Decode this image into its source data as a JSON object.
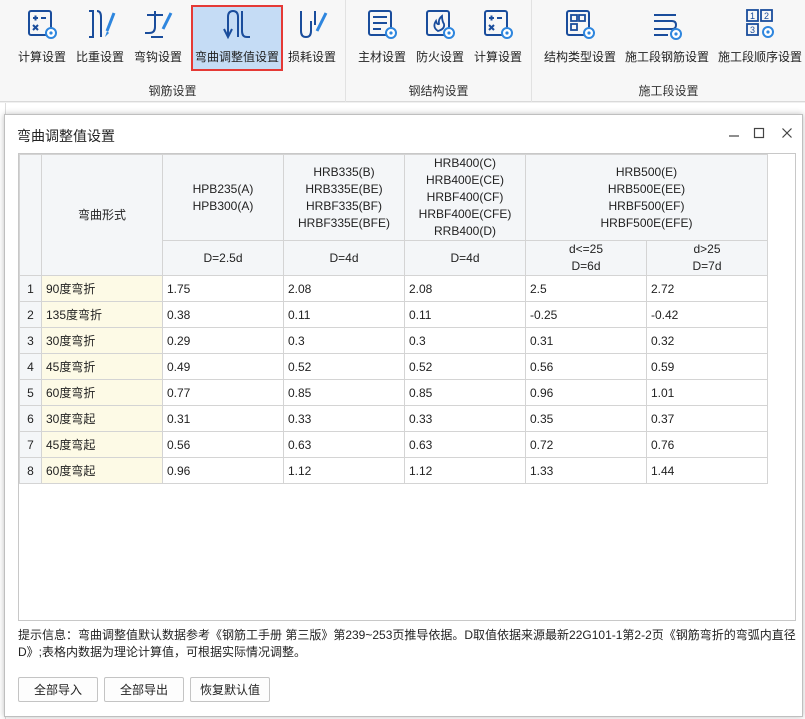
{
  "ribbon": {
    "groups": [
      {
        "label": "钢筋设置",
        "buttons": [
          {
            "label": "计算设置",
            "icon": "calc-settings-icon"
          },
          {
            "label": "比重设置",
            "icon": "weight-settings-icon"
          },
          {
            "label": "弯钩设置",
            "icon": "hook-settings-icon"
          },
          {
            "label": "弯曲调整值设置",
            "icon": "bend-adjust-icon"
          },
          {
            "label": "损耗设置",
            "icon": "loss-settings-icon"
          }
        ]
      },
      {
        "label": "钢结构设置",
        "buttons": [
          {
            "label": "主材设置",
            "icon": "main-material-icon"
          },
          {
            "label": "防火设置",
            "icon": "fireproof-icon"
          },
          {
            "label": "计算设置",
            "icon": "steel-calc-icon"
          }
        ]
      },
      {
        "label": "施工段设置",
        "buttons": [
          {
            "label": "结构类型设置",
            "icon": "structure-type-icon"
          },
          {
            "label": "施工段钢筋设置",
            "icon": "segment-rebar-icon"
          },
          {
            "label": "施工段顺序设置",
            "icon": "segment-order-icon"
          }
        ]
      }
    ],
    "active_button": "弯曲调整值设置",
    "accent_color": "#1a4d9c",
    "active_bg": "#c5dcf5",
    "highlight_border": "#e53935"
  },
  "dialog": {
    "title": "弯曲调整值设置",
    "minimize_glyph": "—",
    "maximize_glyph": "☐",
    "close_glyph": "✕",
    "grid": {
      "corner_header": "弯曲形式",
      "groups": [
        {
          "lines": [
            "HPB235(A)",
            "HPB300(A)"
          ]
        },
        {
          "lines": [
            "HRB335(B)",
            "HRB335E(BE)",
            "HRBF335(BF)",
            "HRBF335E(BFE)"
          ]
        },
        {
          "lines": [
            "HRB400(C)",
            "HRB400E(CE)",
            "HRBF400(CF)",
            "HRBF400E(CFE)",
            "RRB400(D)"
          ]
        },
        {
          "lines": [
            "HRB500(E)",
            "HRB500E(EE)",
            "HRBF500(EF)",
            "HRBF500E(EFE)"
          ]
        }
      ],
      "subheaders": [
        [
          "D=2.5d"
        ],
        [
          "D=4d"
        ],
        [
          "D=4d"
        ],
        [
          "d<=25",
          "D=6d"
        ],
        [
          "d>25",
          "D=7d"
        ]
      ],
      "rows": [
        {
          "num": "1",
          "form": "90度弯折",
          "values": [
            "1.75",
            "2.08",
            "2.08",
            "2.5",
            "2.72"
          ]
        },
        {
          "num": "2",
          "form": "135度弯折",
          "values": [
            "0.38",
            "0.11",
            "0.11",
            "-0.25",
            "-0.42"
          ]
        },
        {
          "num": "3",
          "form": "30度弯折",
          "values": [
            "0.29",
            "0.3",
            "0.3",
            "0.31",
            "0.32"
          ]
        },
        {
          "num": "4",
          "form": "45度弯折",
          "values": [
            "0.49",
            "0.52",
            "0.52",
            "0.56",
            "0.59"
          ]
        },
        {
          "num": "5",
          "form": "60度弯折",
          "values": [
            "0.77",
            "0.85",
            "0.85",
            "0.96",
            "1.01"
          ]
        },
        {
          "num": "6",
          "form": "30度弯起",
          "values": [
            "0.31",
            "0.33",
            "0.33",
            "0.35",
            "0.37"
          ]
        },
        {
          "num": "7",
          "form": "45度弯起",
          "values": [
            "0.56",
            "0.63",
            "0.63",
            "0.72",
            "0.76"
          ]
        },
        {
          "num": "8",
          "form": "60度弯起",
          "values": [
            "0.96",
            "1.12",
            "1.12",
            "1.33",
            "1.44"
          ]
        }
      ]
    },
    "info_text": "提示信息：弯曲调整值默认数据参考《钢筋工手册  第三版》第239~253页推导依据。D取值依据来源最新22G101-1第2-2页《钢筋弯折的弯弧内直径D》;表格内数据为理论计算值，可根据实际情况调整。",
    "buttons": {
      "import_all": "全部导入",
      "export_all": "全部导出",
      "restore_default": "恢复默认值"
    }
  }
}
